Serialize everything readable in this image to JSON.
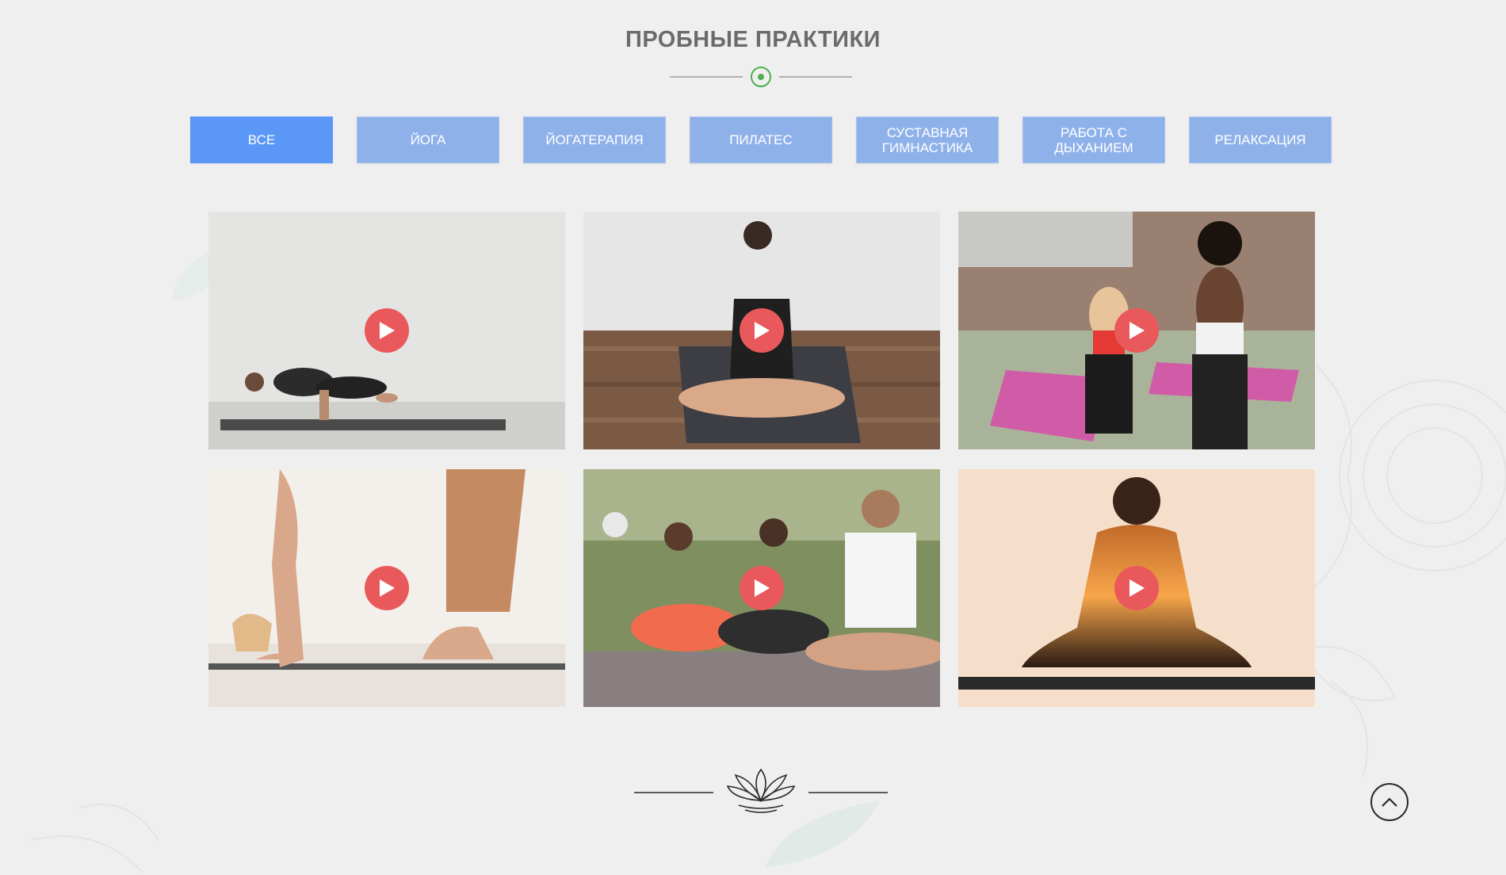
{
  "section": {
    "title": "ПРОБНЫЕ ПРАКТИКИ",
    "accent_color": "#4caf50"
  },
  "filters": [
    {
      "label": "ВСЕ",
      "active": true
    },
    {
      "label": "ЙОГА",
      "active": false
    },
    {
      "label": "ЙОГАТЕРАПИЯ",
      "active": false
    },
    {
      "label": "ПИЛАТЕС",
      "active": false
    },
    {
      "label": "СУСТАВНАЯ ГИМНАСТИКА",
      "active": false
    },
    {
      "label": "РАБОТА С ДЫХАНИЕМ",
      "active": false
    },
    {
      "label": "РЕЛАКСАЦИЯ",
      "active": false
    }
  ],
  "colors": {
    "filter_active": "#5a97f7",
    "filter_inactive": "#8fb1ea",
    "play_button": "#e9595c",
    "background": "#efefef"
  },
  "videos": [
    {
      "thumbnail": "woman-crow-pose-photo",
      "icon": "play-icon"
    },
    {
      "thumbnail": "woman-seated-twist-photo",
      "icon": "play-icon"
    },
    {
      "thumbnail": "group-fitness-class-photo",
      "icon": "play-icon"
    },
    {
      "thumbnail": "forward-fold-feet-photo",
      "icon": "play-icon"
    },
    {
      "thumbnail": "group-meditation-outdoors-photo",
      "icon": "play-icon"
    },
    {
      "thumbnail": "meditation-silhouette-sunset-photo",
      "icon": "play-icon"
    }
  ],
  "icons": {
    "title_divider": "circle-dot-icon",
    "footer_divider": "lotus-icon",
    "scroll_top": "chevron-up-icon"
  }
}
